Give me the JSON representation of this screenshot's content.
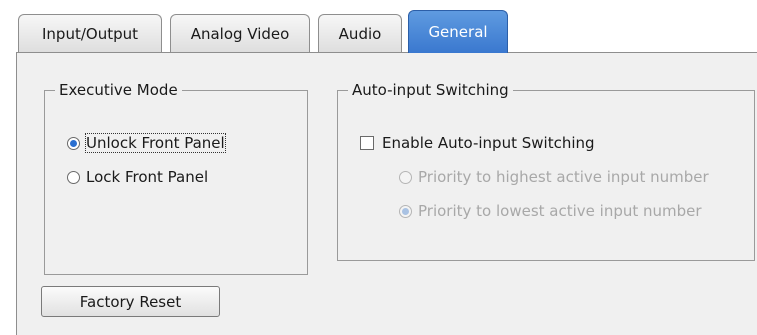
{
  "tabs": [
    {
      "label": "Input/Output",
      "active": false
    },
    {
      "label": "Analog Video",
      "active": false
    },
    {
      "label": "Audio",
      "active": false
    },
    {
      "label": "General",
      "active": true
    }
  ],
  "executive_mode": {
    "title": "Executive Mode",
    "options": [
      {
        "label": "Unlock Front Panel",
        "selected": true
      },
      {
        "label": "Lock Front Panel",
        "selected": false
      }
    ]
  },
  "auto_input": {
    "title": "Auto-input Switching",
    "enable_label": "Enable Auto-input Switching",
    "enable_checked": false,
    "options": [
      {
        "label": "Priority to highest active input number",
        "selected": false,
        "enabled": false
      },
      {
        "label": "Priority to lowest active input number",
        "selected": true,
        "enabled": false
      }
    ]
  },
  "factory_reset_label": "Factory Reset",
  "colors": {
    "active_tab": "#3a78cf",
    "panel_background": "#f0f0f0",
    "disabled_text": "#a8a8a8"
  }
}
